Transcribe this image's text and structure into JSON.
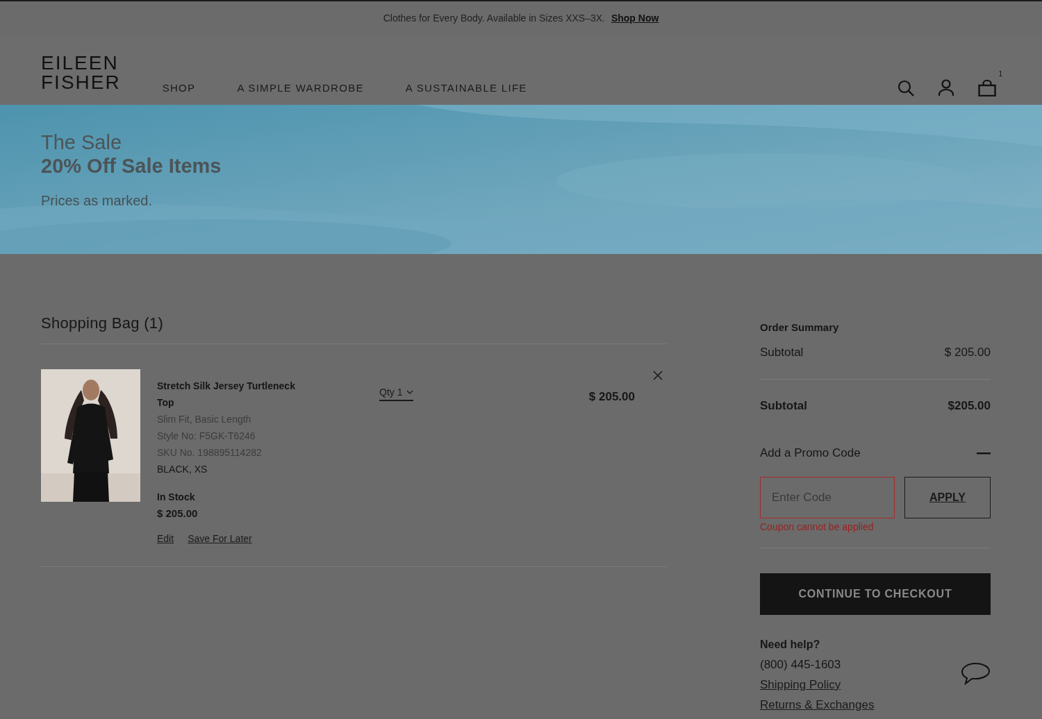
{
  "announcement": {
    "text": "Clothes for Every Body. Available in Sizes XXS–3X.",
    "link": "Shop Now"
  },
  "header": {
    "logo": [
      "EILEEN",
      "FISHER"
    ],
    "nav": [
      "SHOP",
      "A SIMPLE WARDROBE",
      "A SUSTAINABLE LIFE"
    ],
    "bag_count": "1"
  },
  "hero": {
    "kicker": "The Sale",
    "title": "20% Off Sale Items",
    "subtitle": "Prices as marked."
  },
  "bag": {
    "title": "Shopping Bag (1)",
    "items": [
      {
        "name": "Stretch Silk Jersey Turtleneck Top",
        "details": [
          "Slim Fit, Basic Length",
          "Style No: F5GK-T6246",
          "SKU No. 198895114282"
        ],
        "variant": "BLACK, XS",
        "stock": "In Stock",
        "unit_price": "$ 205.00",
        "qty": "Qty 1",
        "price": "$ 205.00",
        "actions": [
          "Edit",
          "Save For Later"
        ]
      }
    ]
  },
  "summary": {
    "title": "Order Summary",
    "rows": [
      {
        "kind": "line",
        "label": "Subtotal",
        "value": "$ 205.00"
      },
      {
        "kind": "total",
        "label": "Subtotal",
        "value": "$205.00"
      }
    ],
    "promo": {
      "label": "Add a Promo Code",
      "expanded": true,
      "placeholder": "Enter Code",
      "button": "APPLY",
      "error": "Coupon cannot be applied"
    },
    "checkout": "CONTINUE TO CHECKOUT",
    "help": {
      "title": "Need help?",
      "phone": "(800) 445-1603",
      "links": [
        "Shipping Policy",
        "Returns & Exchanges"
      ]
    }
  }
}
